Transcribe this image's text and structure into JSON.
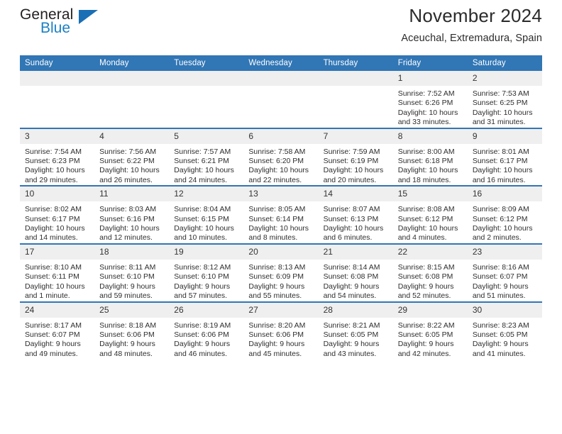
{
  "brand": {
    "name_top": "General",
    "name_bottom": "Blue",
    "accent_color": "#1b7fc4",
    "flag_color": "#1b6fb5"
  },
  "header": {
    "title": "November 2024",
    "subtitle": "Aceuchal, Extremadura, Spain"
  },
  "theme": {
    "header_blue": "#3176b5",
    "daynum_gray": "#efefef",
    "text": "#2e2e2e"
  },
  "calendar": {
    "weekday_headers": [
      "Sunday",
      "Monday",
      "Tuesday",
      "Wednesday",
      "Thursday",
      "Friday",
      "Saturday"
    ],
    "weeks": [
      [
        {
          "day": "",
          "lines": []
        },
        {
          "day": "",
          "lines": []
        },
        {
          "day": "",
          "lines": []
        },
        {
          "day": "",
          "lines": []
        },
        {
          "day": "",
          "lines": []
        },
        {
          "day": "1",
          "lines": [
            "Sunrise: 7:52 AM",
            "Sunset: 6:26 PM",
            "Daylight: 10 hours and 33 minutes."
          ]
        },
        {
          "day": "2",
          "lines": [
            "Sunrise: 7:53 AM",
            "Sunset: 6:25 PM",
            "Daylight: 10 hours and 31 minutes."
          ]
        }
      ],
      [
        {
          "day": "3",
          "lines": [
            "Sunrise: 7:54 AM",
            "Sunset: 6:23 PM",
            "Daylight: 10 hours and 29 minutes."
          ]
        },
        {
          "day": "4",
          "lines": [
            "Sunrise: 7:56 AM",
            "Sunset: 6:22 PM",
            "Daylight: 10 hours and 26 minutes."
          ]
        },
        {
          "day": "5",
          "lines": [
            "Sunrise: 7:57 AM",
            "Sunset: 6:21 PM",
            "Daylight: 10 hours and 24 minutes."
          ]
        },
        {
          "day": "6",
          "lines": [
            "Sunrise: 7:58 AM",
            "Sunset: 6:20 PM",
            "Daylight: 10 hours and 22 minutes."
          ]
        },
        {
          "day": "7",
          "lines": [
            "Sunrise: 7:59 AM",
            "Sunset: 6:19 PM",
            "Daylight: 10 hours and 20 minutes."
          ]
        },
        {
          "day": "8",
          "lines": [
            "Sunrise: 8:00 AM",
            "Sunset: 6:18 PM",
            "Daylight: 10 hours and 18 minutes."
          ]
        },
        {
          "day": "9",
          "lines": [
            "Sunrise: 8:01 AM",
            "Sunset: 6:17 PM",
            "Daylight: 10 hours and 16 minutes."
          ]
        }
      ],
      [
        {
          "day": "10",
          "lines": [
            "Sunrise: 8:02 AM",
            "Sunset: 6:17 PM",
            "Daylight: 10 hours and 14 minutes."
          ]
        },
        {
          "day": "11",
          "lines": [
            "Sunrise: 8:03 AM",
            "Sunset: 6:16 PM",
            "Daylight: 10 hours and 12 minutes."
          ]
        },
        {
          "day": "12",
          "lines": [
            "Sunrise: 8:04 AM",
            "Sunset: 6:15 PM",
            "Daylight: 10 hours and 10 minutes."
          ]
        },
        {
          "day": "13",
          "lines": [
            "Sunrise: 8:05 AM",
            "Sunset: 6:14 PM",
            "Daylight: 10 hours and 8 minutes."
          ]
        },
        {
          "day": "14",
          "lines": [
            "Sunrise: 8:07 AM",
            "Sunset: 6:13 PM",
            "Daylight: 10 hours and 6 minutes."
          ]
        },
        {
          "day": "15",
          "lines": [
            "Sunrise: 8:08 AM",
            "Sunset: 6:12 PM",
            "Daylight: 10 hours and 4 minutes."
          ]
        },
        {
          "day": "16",
          "lines": [
            "Sunrise: 8:09 AM",
            "Sunset: 6:12 PM",
            "Daylight: 10 hours and 2 minutes."
          ]
        }
      ],
      [
        {
          "day": "17",
          "lines": [
            "Sunrise: 8:10 AM",
            "Sunset: 6:11 PM",
            "Daylight: 10 hours and 1 minute."
          ]
        },
        {
          "day": "18",
          "lines": [
            "Sunrise: 8:11 AM",
            "Sunset: 6:10 PM",
            "Daylight: 9 hours and 59 minutes."
          ]
        },
        {
          "day": "19",
          "lines": [
            "Sunrise: 8:12 AM",
            "Sunset: 6:10 PM",
            "Daylight: 9 hours and 57 minutes."
          ]
        },
        {
          "day": "20",
          "lines": [
            "Sunrise: 8:13 AM",
            "Sunset: 6:09 PM",
            "Daylight: 9 hours and 55 minutes."
          ]
        },
        {
          "day": "21",
          "lines": [
            "Sunrise: 8:14 AM",
            "Sunset: 6:08 PM",
            "Daylight: 9 hours and 54 minutes."
          ]
        },
        {
          "day": "22",
          "lines": [
            "Sunrise: 8:15 AM",
            "Sunset: 6:08 PM",
            "Daylight: 9 hours and 52 minutes."
          ]
        },
        {
          "day": "23",
          "lines": [
            "Sunrise: 8:16 AM",
            "Sunset: 6:07 PM",
            "Daylight: 9 hours and 51 minutes."
          ]
        }
      ],
      [
        {
          "day": "24",
          "lines": [
            "Sunrise: 8:17 AM",
            "Sunset: 6:07 PM",
            "Daylight: 9 hours and 49 minutes."
          ]
        },
        {
          "day": "25",
          "lines": [
            "Sunrise: 8:18 AM",
            "Sunset: 6:06 PM",
            "Daylight: 9 hours and 48 minutes."
          ]
        },
        {
          "day": "26",
          "lines": [
            "Sunrise: 8:19 AM",
            "Sunset: 6:06 PM",
            "Daylight: 9 hours and 46 minutes."
          ]
        },
        {
          "day": "27",
          "lines": [
            "Sunrise: 8:20 AM",
            "Sunset: 6:06 PM",
            "Daylight: 9 hours and 45 minutes."
          ]
        },
        {
          "day": "28",
          "lines": [
            "Sunrise: 8:21 AM",
            "Sunset: 6:05 PM",
            "Daylight: 9 hours and 43 minutes."
          ]
        },
        {
          "day": "29",
          "lines": [
            "Sunrise: 8:22 AM",
            "Sunset: 6:05 PM",
            "Daylight: 9 hours and 42 minutes."
          ]
        },
        {
          "day": "30",
          "lines": [
            "Sunrise: 8:23 AM",
            "Sunset: 6:05 PM",
            "Daylight: 9 hours and 41 minutes."
          ]
        }
      ]
    ]
  }
}
